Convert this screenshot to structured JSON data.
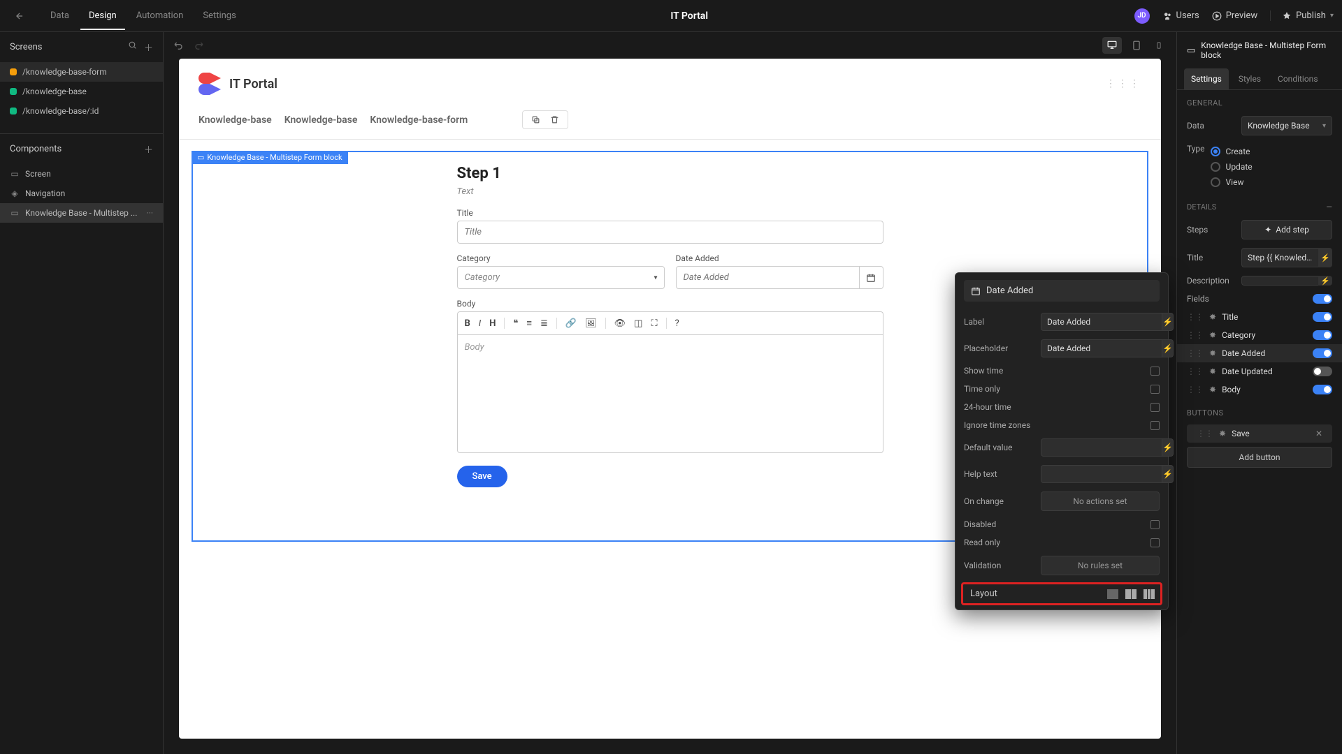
{
  "top": {
    "tabs": [
      "Data",
      "Design",
      "Automation",
      "Settings"
    ],
    "active_tab_index": 1,
    "title": "IT Portal",
    "avatar": "JD",
    "users": "Users",
    "preview": "Preview",
    "publish": "Publish"
  },
  "left": {
    "screens_title": "Screens",
    "screens": [
      {
        "path": "/knowledge-base-form",
        "color": "#f59e0b",
        "selected": true
      },
      {
        "path": "/knowledge-base",
        "color": "#10b981",
        "selected": false
      },
      {
        "path": "/knowledge-base/:id",
        "color": "#10b981",
        "selected": false
      }
    ],
    "components_title": "Components",
    "components": [
      {
        "label": "Screen",
        "icon": "□",
        "selected": false
      },
      {
        "label": "Navigation",
        "icon": "◈",
        "selected": false
      },
      {
        "label": "Knowledge Base - Multistep ...",
        "icon": "▭",
        "selected": true,
        "more": "···"
      }
    ]
  },
  "canvas": {
    "app_title": "IT Portal",
    "breadcrumbs": [
      "Knowledge-base",
      "Knowledge-base",
      "Knowledge-base-form"
    ],
    "selection_tag": "Knowledge Base - Multistep Form block",
    "step_title": "Step 1",
    "step_sub": "Text",
    "fields": {
      "title_label": "Title",
      "title_placeholder": "Title",
      "category_label": "Category",
      "category_placeholder": "Category",
      "date_label": "Date Added",
      "date_placeholder": "Date Added",
      "body_label": "Body",
      "body_placeholder": "Body"
    },
    "save_label": "Save"
  },
  "right": {
    "header": "Knowledge Base - Multistep Form block",
    "tabs": [
      "Settings",
      "Styles",
      "Conditions"
    ],
    "active_tab_index": 0,
    "section_general": "GENERAL",
    "data_label": "Data",
    "data_value": "Knowledge Base",
    "type_label": "Type",
    "type_options": [
      "Create",
      "Update",
      "View"
    ],
    "type_selected": 0,
    "section_details": "DETAILS",
    "steps_label": "Steps",
    "add_step": "Add step",
    "title_label": "Title",
    "title_value": "Step {{ Knowledge …",
    "desc_label": "Description",
    "fields_label": "Fields",
    "field_items": [
      {
        "name": "Title",
        "on": true
      },
      {
        "name": "Category",
        "on": true
      },
      {
        "name": "Date Added",
        "on": true,
        "selected": true
      },
      {
        "name": "Date Updated",
        "on": false
      },
      {
        "name": "Body",
        "on": true
      }
    ],
    "buttons_label": "Buttons",
    "save_button": "Save",
    "add_button": "Add button"
  },
  "popover": {
    "header": "Date Added",
    "label_label": "Label",
    "label_value": "Date Added",
    "placeholder_label": "Placeholder",
    "placeholder_value": "Date Added",
    "show_time": "Show time",
    "time_only": "Time only",
    "hour24": "24-hour time",
    "ignore_tz": "Ignore time zones",
    "default_label": "Default value",
    "help_label": "Help text",
    "onchange_label": "On change",
    "onchange_value": "No actions set",
    "disabled_label": "Disabled",
    "readonly_label": "Read only",
    "validation_label": "Validation",
    "validation_value": "No rules set",
    "layout_label": "Layout"
  }
}
